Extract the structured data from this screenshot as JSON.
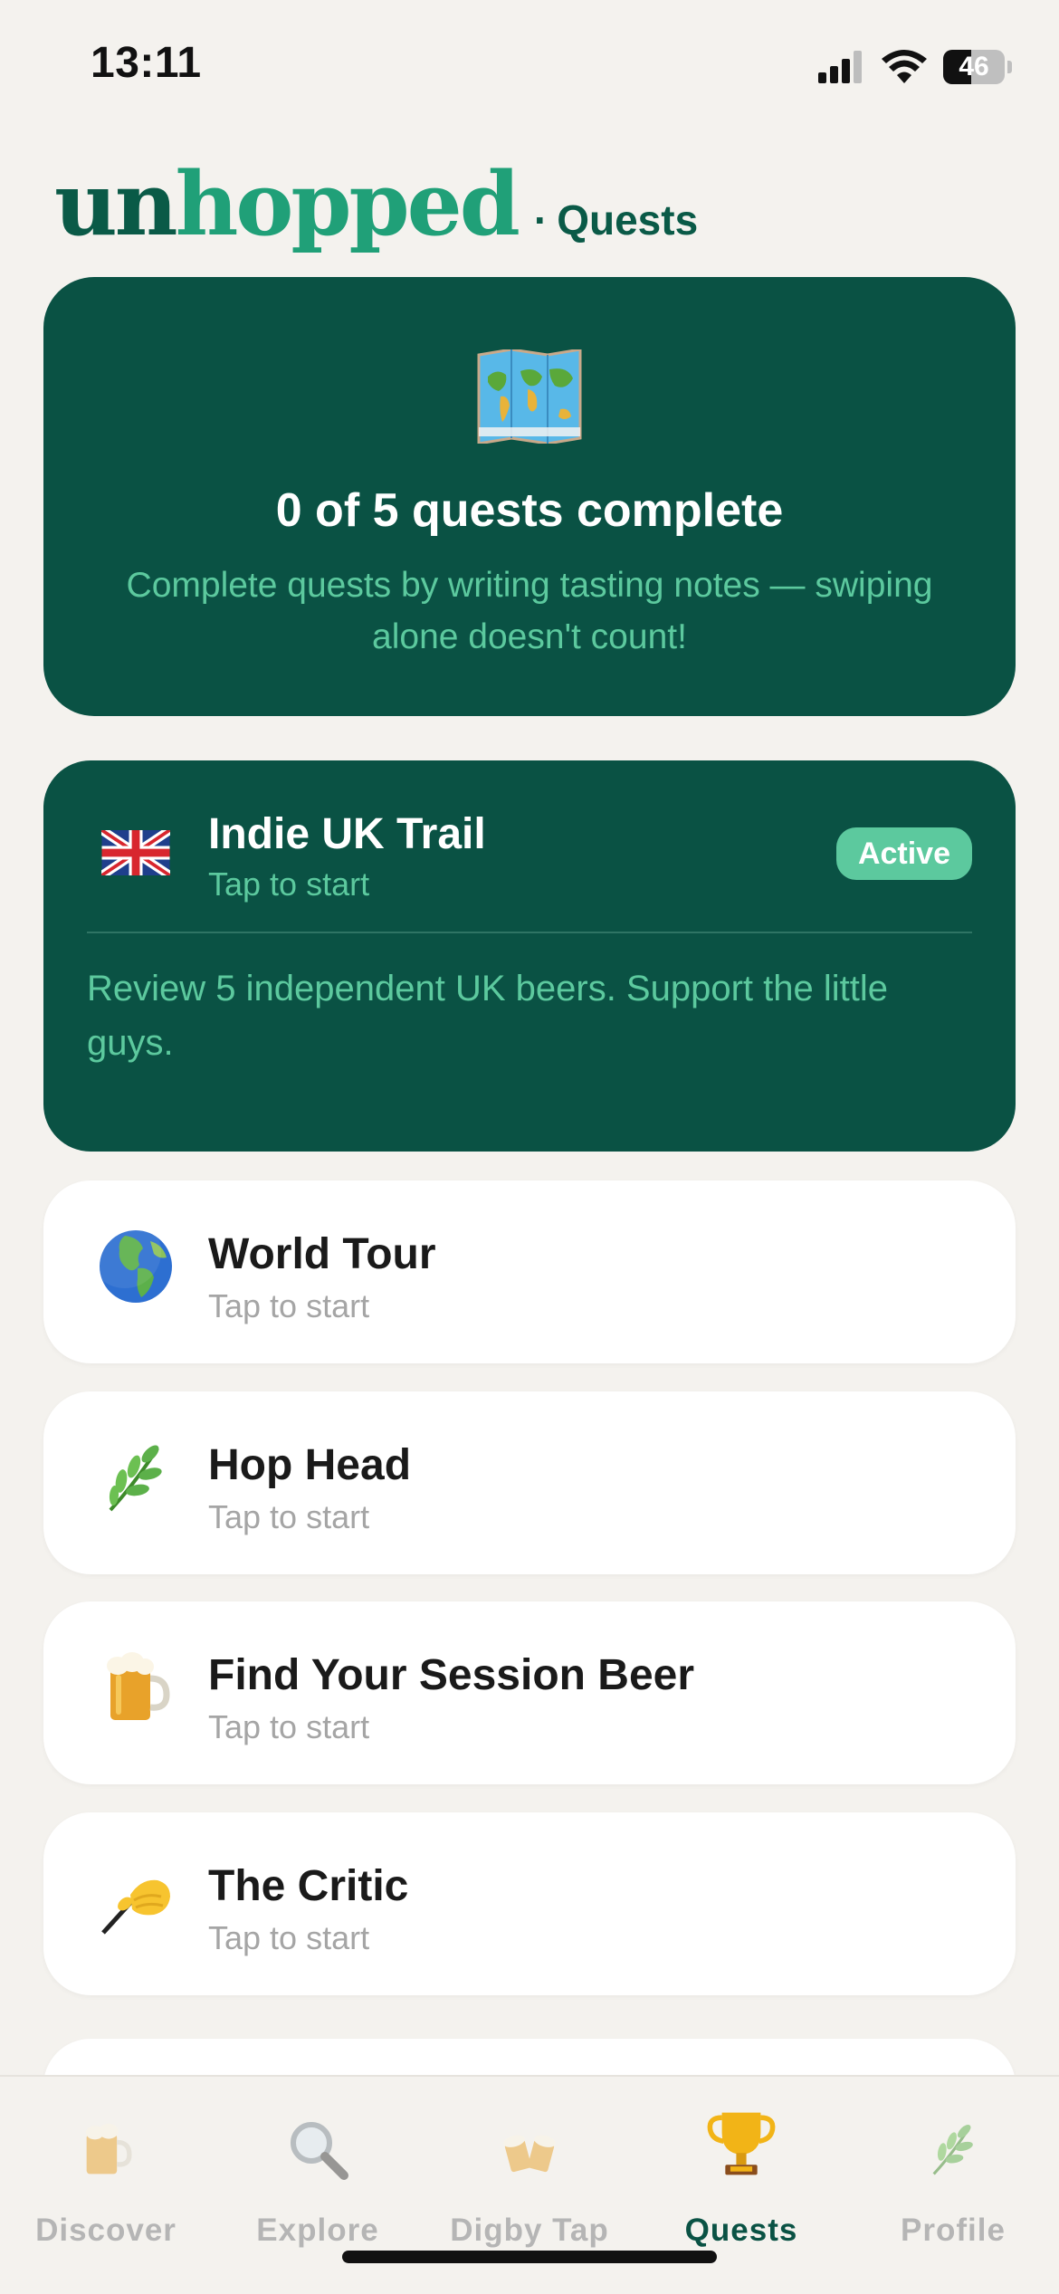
{
  "status_bar": {
    "time": "13:11",
    "battery_percent": "46",
    "battery_level": 0.46,
    "icons": [
      "signal-icon",
      "wifi-icon",
      "battery-icon"
    ]
  },
  "header": {
    "logo_part1": "un",
    "logo_part2": "hopped",
    "separator": "·",
    "section": "Quests",
    "colors": {
      "dark_green": "#0a5a47",
      "light_green": "#20a078"
    }
  },
  "summary": {
    "icon": "world-map-icon",
    "heading": "0 of 5 quests complete",
    "description": "Complete quests by writing tasting notes — swiping alone doesn't count!"
  },
  "quests": [
    {
      "icon": "uk-flag-icon",
      "title": "Indie UK Trail",
      "subtitle": "Tap to start",
      "badge": "Active",
      "description": "Review 5 independent UK beers. Support the little guys."
    },
    {
      "icon": "globe-icon",
      "title": "World Tour",
      "subtitle": "Tap to start"
    },
    {
      "icon": "herb-icon",
      "title": "Hop Head",
      "subtitle": "Tap to start"
    },
    {
      "icon": "beer-mug-icon",
      "title": "Find Your Session Beer",
      "subtitle": "Tap to start"
    },
    {
      "icon": "writing-hand-icon",
      "title": "The Critic",
      "subtitle": "Tap to start"
    }
  ],
  "tab_bar": {
    "items": [
      {
        "label": "Discover",
        "icon": "beer-mug-icon"
      },
      {
        "label": "Explore",
        "icon": "magnifying-glass-icon"
      },
      {
        "label": "Digby Tap",
        "icon": "clinking-beers-icon"
      },
      {
        "label": "Quests",
        "icon": "trophy-icon",
        "selected": true
      },
      {
        "label": "Profile",
        "icon": "herb-icon"
      }
    ]
  },
  "colors": {
    "background": "#f4f2ee",
    "card_dark": "#0a5244",
    "accent_mint": "#5cc99e",
    "selected_tab": "#0a5244"
  }
}
